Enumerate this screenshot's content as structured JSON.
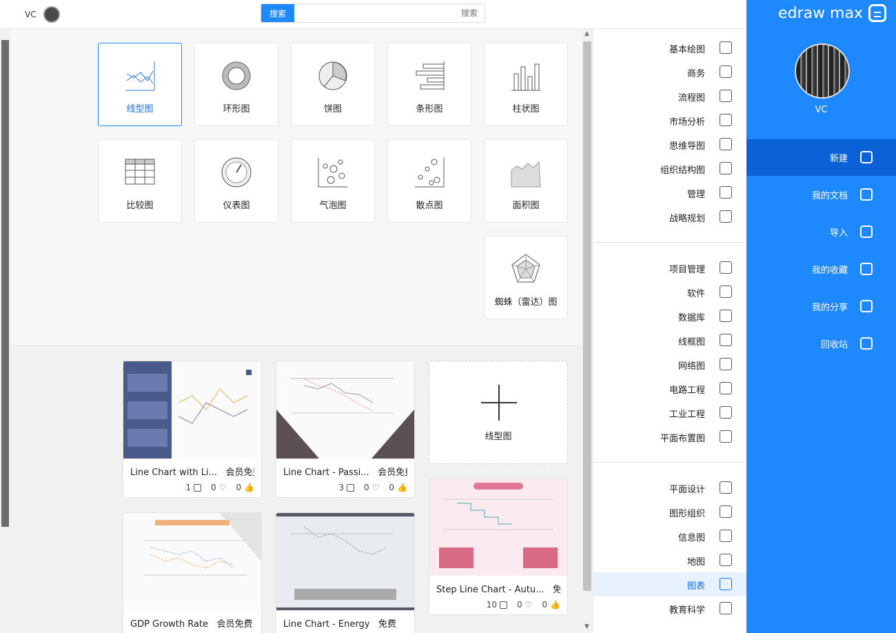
{
  "header": {
    "user_name": "VC",
    "search_button": "搜索",
    "search_placeholder": "搜索"
  },
  "brand": {
    "name": "edraw max"
  },
  "profile": {
    "name": "VC"
  },
  "rail": [
    {
      "label": "新建",
      "icon": "plus-square-icon",
      "active": true
    },
    {
      "label": "我的文档",
      "icon": "document-icon"
    },
    {
      "label": "导入",
      "icon": "import-icon"
    },
    {
      "label": "我的收藏",
      "icon": "star-icon"
    },
    {
      "label": "我的分享",
      "icon": "share-icon"
    },
    {
      "label": "回收站",
      "icon": "trash-icon"
    }
  ],
  "categories": [
    [
      "基本绘图",
      "商务",
      "流程图",
      "市场分析",
      "思维导图",
      "组织结构图",
      "管理",
      "战略规划"
    ],
    [
      "项目管理",
      "软件",
      "数据库",
      "线框图",
      "网络图",
      "电路工程",
      "工业工程",
      "平面布置图"
    ],
    [
      "平面设计",
      "图形组织",
      "信息图",
      "地图",
      "图表",
      "教育科学"
    ]
  ],
  "selected_category": "图表",
  "chart_types": [
    "柱状图",
    "条形图",
    "饼图",
    "环形图",
    "线型图",
    "面积图",
    "散点图",
    "气泡图",
    "仪表图",
    "比较图",
    "蜘蛛（雷达）图"
  ],
  "selected_chart_type": "线型图",
  "new_card": {
    "label": "线型图"
  },
  "templates": [
    {
      "title": "Line Chart - Passi...",
      "badge": "会员免费",
      "likes": "0",
      "hearts": "0",
      "copies": "3"
    },
    {
      "title": "Line Chart with Li...",
      "badge": "会员免费",
      "likes": "0",
      "hearts": "0",
      "copies": "1"
    },
    {
      "title": "Step Line Chart - Autu...",
      "badge": "免费",
      "likes": "0",
      "hearts": "0",
      "copies": "10"
    },
    {
      "title": "Line Chart - Energy",
      "badge": "免费"
    },
    {
      "title": "GDP Growth Rate",
      "badge": "会员免费"
    }
  ]
}
